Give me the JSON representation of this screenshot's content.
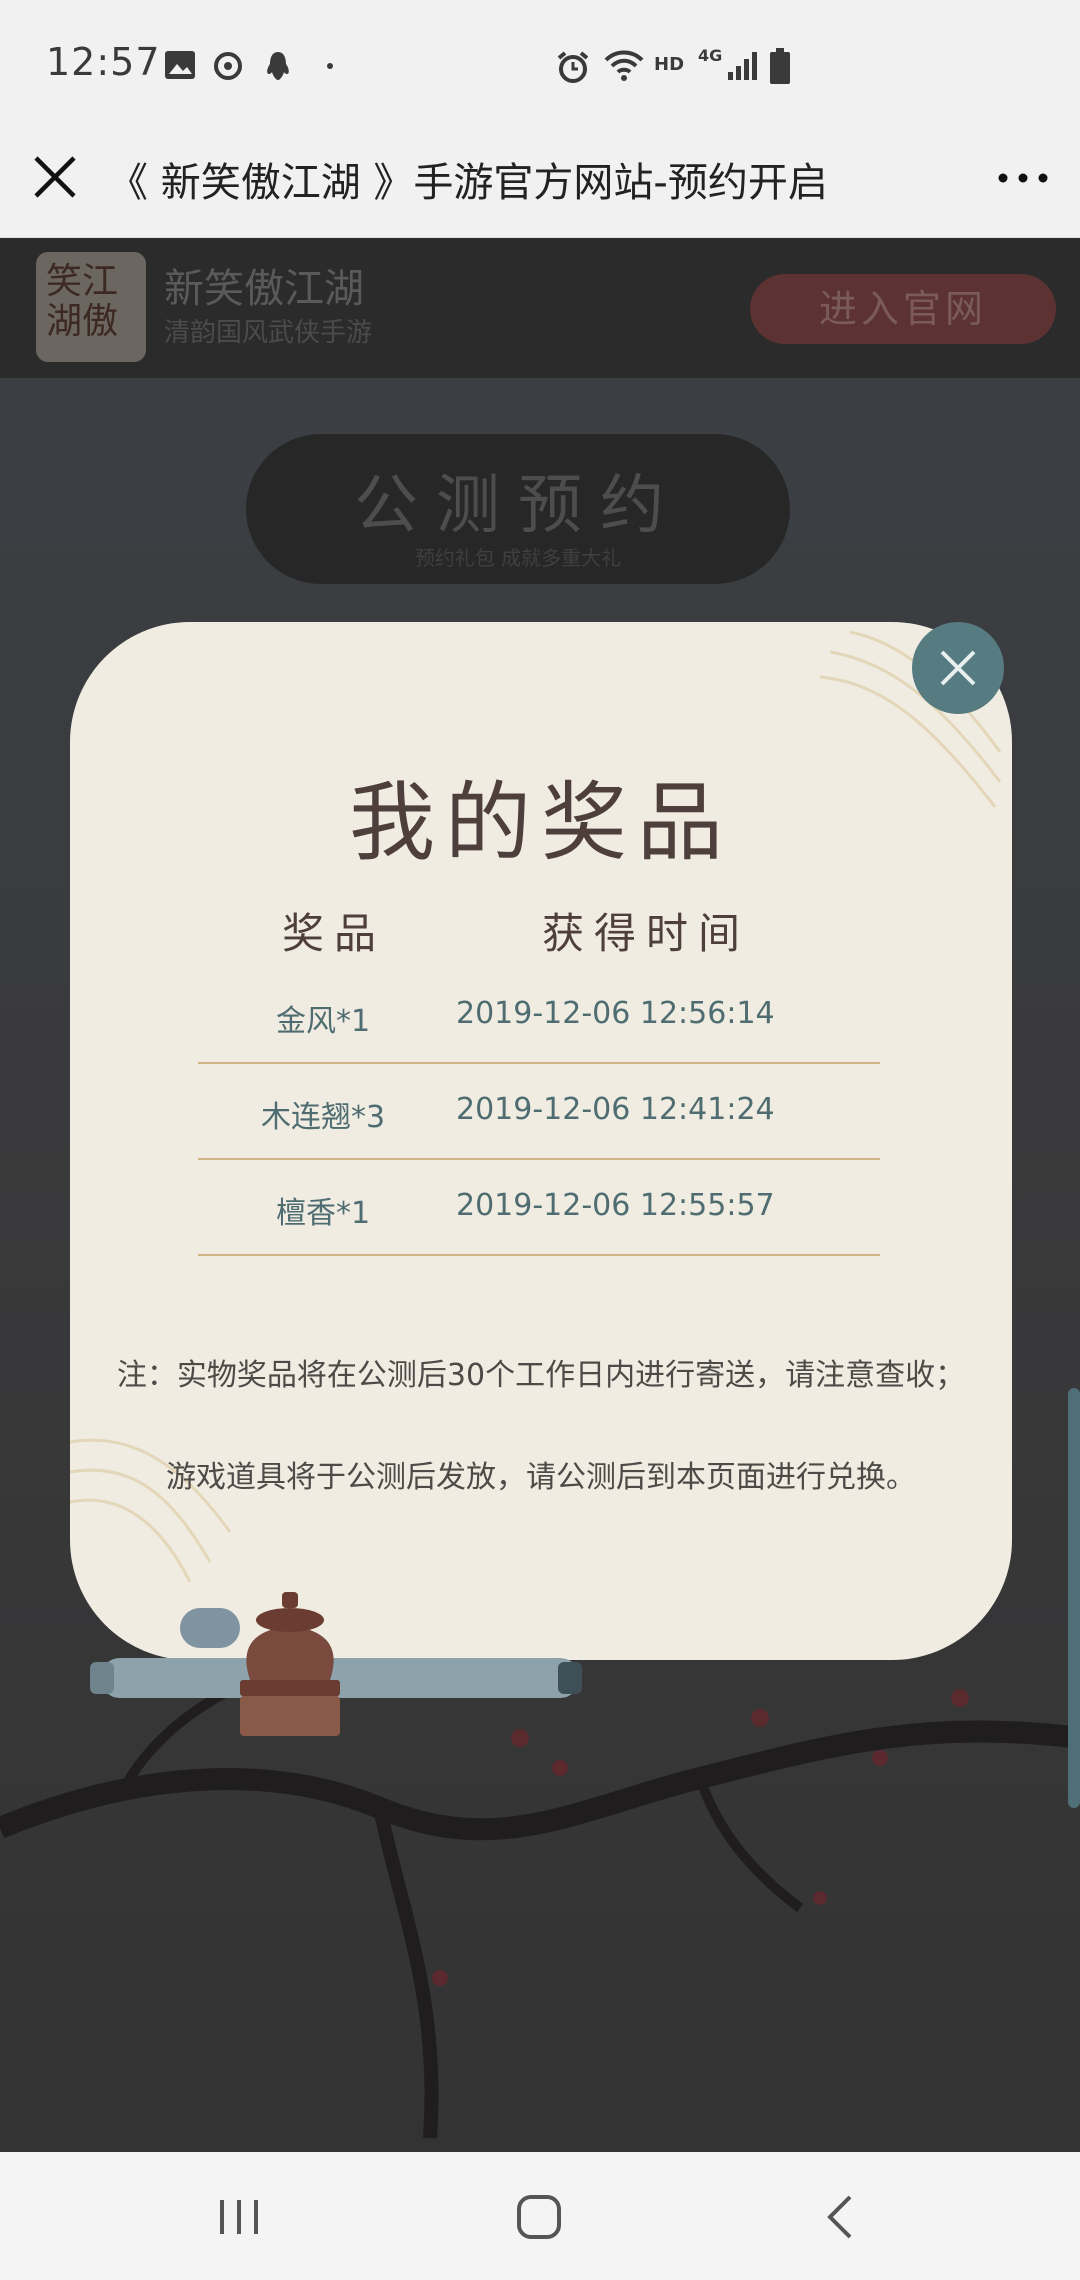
{
  "status_bar": {
    "time": "12:57",
    "network": "HD",
    "network_type": "4G"
  },
  "title_bar": {
    "title": "《 新笑傲江湖 》手游官方网站-预约开启"
  },
  "site": {
    "logo_text": "笑江湖傲",
    "name": "新笑傲江湖",
    "slogan": "清韵国风武侠手游",
    "enter_button": "进入官网",
    "reserve_title": "公测预约",
    "reserve_subtitle": "预约礼包 成就多重大礼"
  },
  "modal": {
    "title": "我的奖品",
    "columns": {
      "prize": "奖品",
      "time": "获得时间"
    },
    "rows": [
      {
        "prize": "金风*1",
        "time": "2019-12-06 12:56:14"
      },
      {
        "prize": "木连翘*3",
        "time": "2019-12-06 12:41:24"
      },
      {
        "prize": "檀香*1",
        "time": "2019-12-06 12:55:57"
      }
    ],
    "note_1": "注：实物奖品将在公测后30个工作日内进行寄送，请注意查收；",
    "note_2": "游戏道具将于公测后发放，请公测后到本页面进行兑换。"
  },
  "colors": {
    "modal_bg": "#f0ece2",
    "accent_teal": "#567b80",
    "row_divider": "#d1b388",
    "text_dark": "#4f3f3c"
  },
  "icons": [
    "image-icon",
    "netease-icon",
    "qq-icon",
    "alarm-icon",
    "wifi-icon",
    "signal-icon",
    "battery-icon",
    "close-icon",
    "more-icon",
    "recents-icon",
    "home-icon",
    "back-icon"
  ]
}
